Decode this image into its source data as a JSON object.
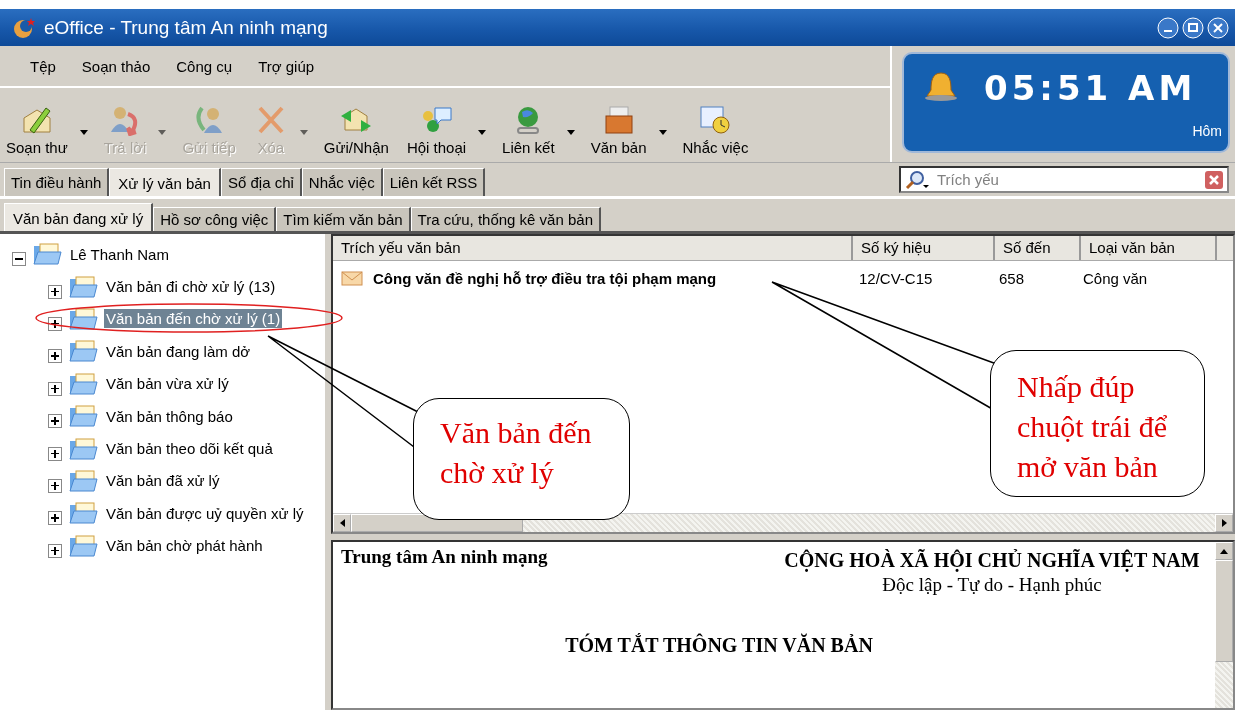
{
  "window": {
    "title": "eOffice - Trung tâm An ninh mạng"
  },
  "menu": [
    "Tệp",
    "Soạn thảo",
    "Công cụ",
    "Trợ giúp"
  ],
  "toolbar": [
    {
      "label": "Soạn thư",
      "disabled": false,
      "dropdown": true
    },
    {
      "label": "Trả lời",
      "disabled": true,
      "dropdown": true
    },
    {
      "label": "Gửi tiếp",
      "disabled": true,
      "dropdown": false
    },
    {
      "label": "Xóa",
      "disabled": true,
      "dropdown": true
    },
    {
      "label": "Gửi/Nhận",
      "disabled": false,
      "dropdown": false
    },
    {
      "label": "Hội thoại",
      "disabled": false,
      "dropdown": true
    },
    {
      "label": "Liên kết",
      "disabled": false,
      "dropdown": true
    },
    {
      "label": "Văn bản",
      "disabled": false,
      "dropdown": true
    },
    {
      "label": "Nhắc việc",
      "disabled": false,
      "dropdown": false
    }
  ],
  "clock": {
    "time": "05:51 AM",
    "caption": "Hôm"
  },
  "tabs": [
    {
      "label": "Tin điều hành",
      "selected": false
    },
    {
      "label": "Xử lý văn bản",
      "selected": true
    },
    {
      "label": "Sổ địa chỉ",
      "selected": false
    },
    {
      "label": "Nhắc việc",
      "selected": false
    },
    {
      "label": "Liên kết RSS",
      "selected": false
    }
  ],
  "search": {
    "placeholder": "Trích yếu"
  },
  "subtabs": [
    {
      "label": "Văn bản đang xử lý",
      "selected": true
    },
    {
      "label": "Hồ sơ công việc",
      "selected": false
    },
    {
      "label": "Tìm kiếm văn bản",
      "selected": false
    },
    {
      "label": "Tra cứu, thống kê văn bản",
      "selected": false
    }
  ],
  "tree": {
    "label": "Lê Thanh Nam",
    "expanded": true,
    "children": [
      {
        "label": "Văn bản đi chờ xử lý (13)",
        "selected": false,
        "expanded": false
      },
      {
        "label": "Văn bản đến chờ xử lý (1)",
        "selected": true,
        "expanded": false
      },
      {
        "label": "Văn bản đang làm dở",
        "selected": false,
        "expanded": false
      },
      {
        "label": "Văn bản vừa xử lý",
        "selected": false,
        "expanded": false
      },
      {
        "label": "Văn bản thông báo",
        "selected": false,
        "expanded": false
      },
      {
        "label": "Văn bản theo dõi kết quả",
        "selected": false,
        "expanded": false
      },
      {
        "label": "Văn bản đã xử lý",
        "selected": false,
        "expanded": false
      },
      {
        "label": "Văn bản được uỷ quyền xử lý",
        "selected": false,
        "expanded": false
      },
      {
        "label": "Văn bản chờ phát hành",
        "selected": false,
        "expanded": false
      }
    ]
  },
  "table": {
    "columns": [
      "Trích yếu văn bản",
      "Số ký hiệu",
      "Số đến",
      "Loại văn bản"
    ],
    "rows": [
      {
        "unread": true,
        "cells": [
          "Công văn đề nghị hỗ trợ điều tra tội phạm mạng",
          "12/CV-C15",
          "658",
          "Công văn"
        ]
      }
    ]
  },
  "preview": {
    "organization": "Trung tâm An ninh mạng",
    "nation": "CỘNG HOÀ XÃ HỘI CHỦ NGHĨA VIỆT NAM",
    "motto": "Độc lập - Tự do - Hạnh phúc",
    "heading": "TÓM TẮT THÔNG TIN VĂN BẢN"
  },
  "callouts": [
    {
      "text": "Văn bản đến chờ  xử lý"
    },
    {
      "text": "Nhấp đúp chuột trái để mở văn bản"
    }
  ]
}
